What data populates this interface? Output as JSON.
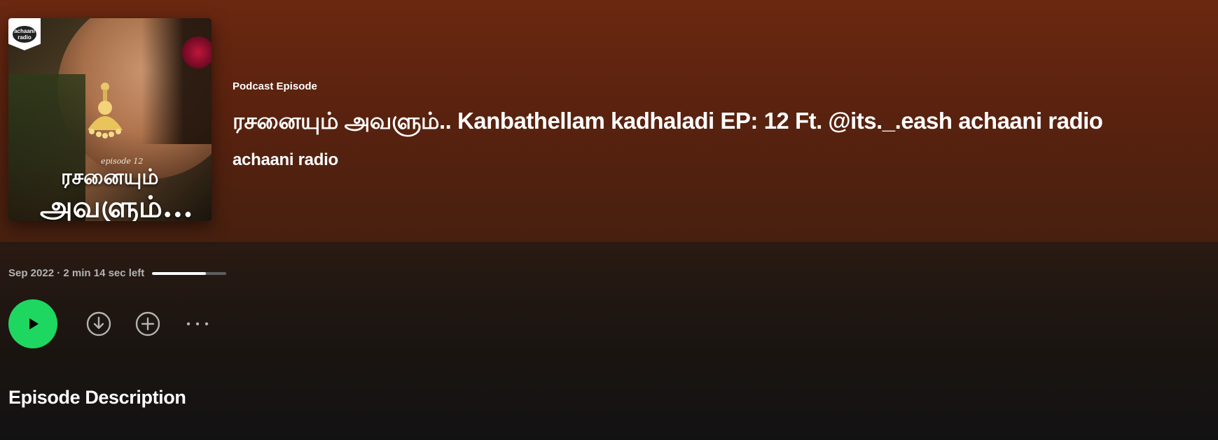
{
  "header": {
    "eyebrow": "Podcast Episode",
    "title": "ரசனையும் அவளும்.. Kanbathellam kadhaladi EP: 12 Ft. @its._.eash achaani radio",
    "show_name": "achaani radio"
  },
  "cover": {
    "episode_label": "episode 12",
    "title_line1": "ரசனையும்",
    "title_line2": "அவளும்...",
    "badge_text": "achaani radio"
  },
  "meta": {
    "text": "Sep 2022 · 2 min 14 sec left",
    "progress_fraction": 0.72
  },
  "actions": {
    "play_icon": "play-icon",
    "download_icon": "download-icon",
    "add_icon": "add-icon",
    "more_icon": "more-icon"
  },
  "section": {
    "title": "Episode Description"
  },
  "colors": {
    "accent": "#1ed760",
    "hero_top": "#6b2810",
    "background": "#121212"
  }
}
